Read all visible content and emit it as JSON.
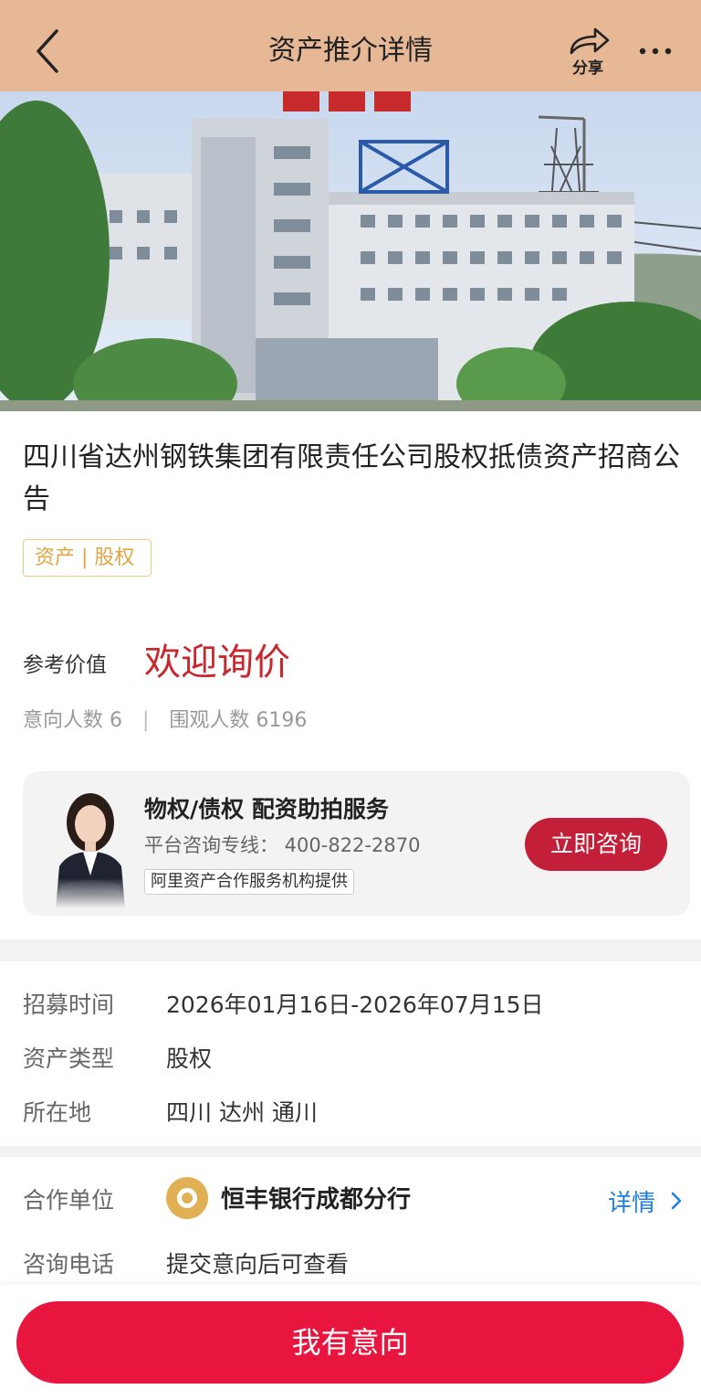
{
  "header": {
    "title": "资产推介详情",
    "share_label": "分享",
    "icons": {
      "back": "chevron-left-icon",
      "share": "share-icon",
      "more": "more-icon"
    }
  },
  "banner": {
    "image": "photo of office building with steel plant towers",
    "current_slide": 1
  },
  "asset": {
    "title": "四川省达州钢铁集团有限责任公司股权抵债资产招商公告",
    "tag": "资产 | 股权"
  },
  "price": {
    "label": "参考价值",
    "value": "欢迎询价"
  },
  "stats": {
    "intent_label": "意向人数 6",
    "separator": "|",
    "views_label": "围观人数 6196"
  },
  "service": {
    "title": "物权/债权  配资助拍服务",
    "phone": "平台咨询专线： 400-822-2870",
    "provider": "阿里资产合作服务机构提供",
    "button": "立即咨询"
  },
  "info": {
    "recruit_time_label": "招募时间",
    "recruit_time_value": "2026年01月16日-2026年07月15日",
    "asset_type_label": "资产类型",
    "asset_type_value": "股权",
    "location_label": "所在地",
    "location_value": "四川 达州 通川"
  },
  "partner": {
    "label": "合作单位",
    "name": "恒丰银行成都分行",
    "detail_link": "详情",
    "phone_label": "咨询电话",
    "phone_value": "提交意向后可查看"
  },
  "footer": {
    "intent_button": "我有意向"
  },
  "colors": {
    "header_bg": "#e6b896",
    "price_red": "#c8272d",
    "consult_button": "#c41f38",
    "intent_button": "#e8153f",
    "tag_orange": "#e0a443",
    "link_blue": "#1e7fe0"
  }
}
